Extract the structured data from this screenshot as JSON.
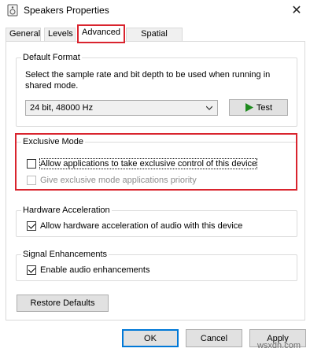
{
  "window": {
    "title": "Speakers Properties",
    "app_icon": "speaker-icon",
    "close_label": "✕"
  },
  "tabs": [
    {
      "label": "General",
      "active": false
    },
    {
      "label": "Levels",
      "active": false
    },
    {
      "label": "Advanced",
      "active": true
    },
    {
      "label": "Spatial sound",
      "active": false
    }
  ],
  "default_format": {
    "legend": "Default Format",
    "description": "Select the sample rate and bit depth to be used when running in shared mode.",
    "selected_format": "24 bit, 48000 Hz",
    "test_button": "Test"
  },
  "exclusive_mode": {
    "legend": "Exclusive Mode",
    "allow_label": "Allow applications to take exclusive control of this device",
    "allow_checked": false,
    "priority_label": "Give exclusive mode applications priority",
    "priority_checked": false,
    "priority_disabled": true
  },
  "hardware_acceleration": {
    "legend": "Hardware Acceleration",
    "label": "Allow hardware acceleration of audio with this device",
    "checked": true
  },
  "signal_enhancements": {
    "legend": "Signal Enhancements",
    "label": "Enable audio enhancements",
    "checked": true
  },
  "buttons": {
    "restore_defaults": "Restore Defaults",
    "ok": "OK",
    "cancel": "Cancel",
    "apply": "Apply"
  },
  "watermark": "wsxdn.com",
  "colors": {
    "highlight": "#d9242e",
    "accent": "#0078d7",
    "test_play": "#1e8a1e"
  }
}
